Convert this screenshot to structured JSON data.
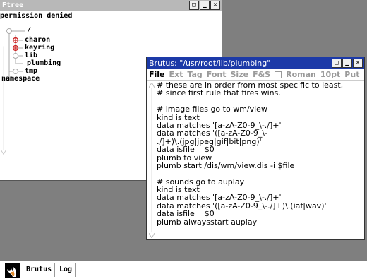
{
  "ftree": {
    "title": "Ftree",
    "status": "permission denied",
    "root": "/",
    "items": [
      "charon",
      "keyring",
      "lib",
      "plumbing",
      "tmp",
      "namespace"
    ]
  },
  "brutus": {
    "title": "Brutus: \"/usr/root/lib/plumbing\"",
    "menu": [
      "File",
      "Ext",
      "Tag",
      "Font",
      "Size",
      "F&S",
      "Roman",
      "10pt",
      "Put"
    ],
    "lines": [
      "# these are in order from most specific to least,",
      "# since first rule that fires wins.",
      "",
      "# image files go to wm/view",
      "kind is text",
      "data matches '[a-zA-Z0-9_\\-./]+'",
      "data matches '([a-zA-Z0-9_\\-",
      "./]+)\\.(jpg|jpeg|gif|bit|png)'",
      "data isfile    $0",
      "plumb to view",
      "plumb start /dis/wm/view.dis -i $file",
      "",
      "# sounds go to auplay",
      "kind is text",
      "data matches '[a-zA-Z0-9_\\-./]+'",
      "data matches '([a-zA-Z0-9_\\-./]+)\\.(iaf|wav)'",
      "data isfile    $0",
      "plumb alwaysstart auplay"
    ]
  },
  "taskbar": {
    "tasks": [
      "Brutus",
      "Log"
    ]
  },
  "colors": {
    "desktop": "#7f7f7f",
    "brutus_title": "#1c3aa8",
    "ftree_title": "#b8b8b8",
    "tree_marker": "#cc2222"
  }
}
